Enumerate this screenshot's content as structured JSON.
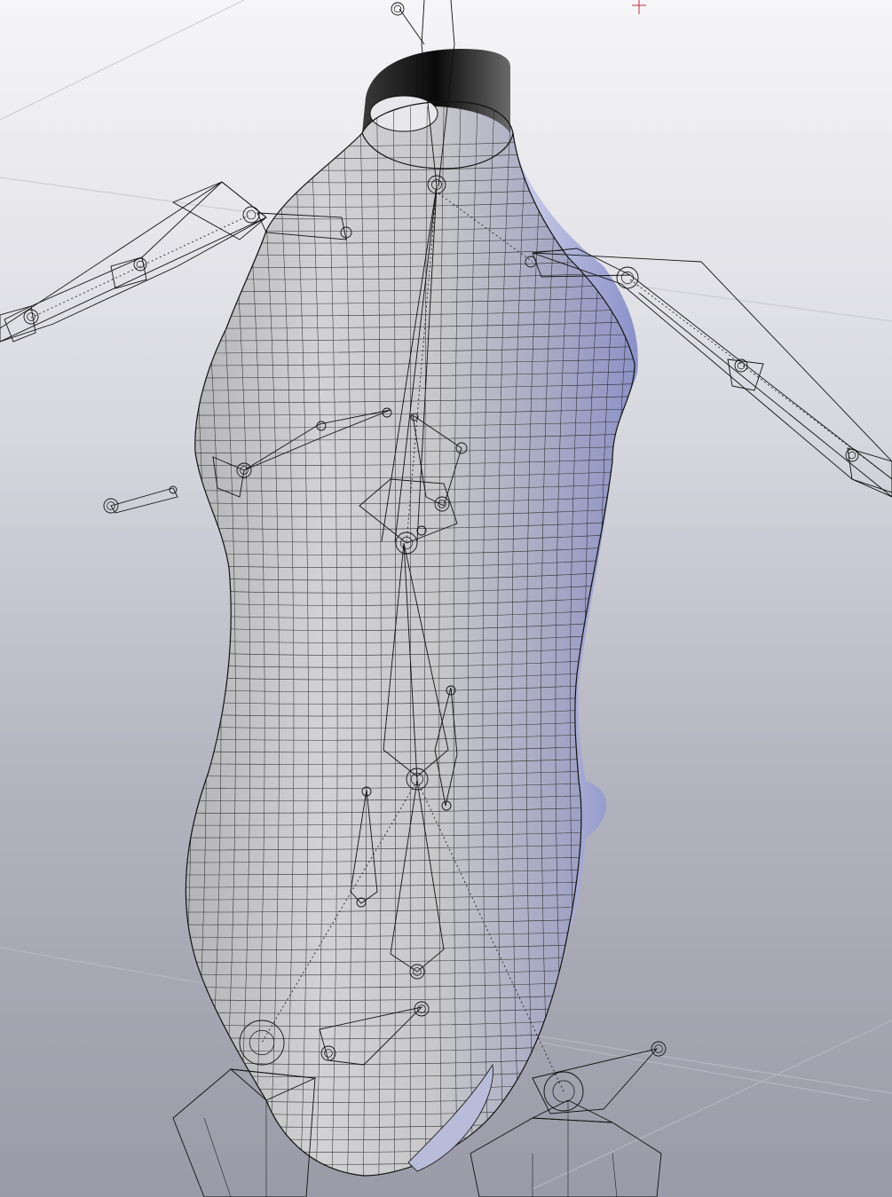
{
  "viewport": {
    "background_top": "#f6f6f8",
    "background_bottom": "#9a9aa8",
    "grid_color": "#c8c8d2",
    "mesh_color": "#1a1a1a",
    "body_fill": "#c4c4c8",
    "shadow_tint": "#9aa0d0"
  },
  "scene": {
    "object": "garment-mesh",
    "rig": "armature-skeleton",
    "icons": [
      "origin-marker-icon",
      "joint-icon"
    ]
  }
}
